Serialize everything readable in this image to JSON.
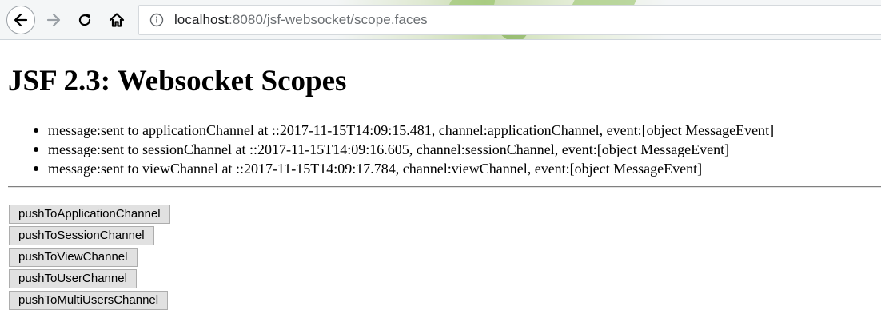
{
  "browser": {
    "url_host": "localhost",
    "url_path": ":8080/jsf-websocket/scope.faces",
    "icons": [
      "back-arrow-icon",
      "forward-arrow-icon",
      "reload-icon",
      "home-icon",
      "info-icon"
    ]
  },
  "page": {
    "title": "JSF 2.3: Websocket Scopes",
    "messages": [
      "message:sent to applicationChannel at ::2017-11-15T14:09:15.481, channel:applicationChannel, event:[object MessageEvent]",
      "message:sent to sessionChannel at ::2017-11-15T14:09:16.605, channel:sessionChannel, event:[object MessageEvent]",
      "message:sent to viewChannel at ::2017-11-15T14:09:17.784, channel:viewChannel, event:[object MessageEvent]"
    ],
    "buttons": [
      "pushToApplicationChannel",
      "pushToSessionChannel",
      "pushToViewChannel",
      "pushToUserChannel",
      "pushToMultiUsersChannel"
    ]
  }
}
